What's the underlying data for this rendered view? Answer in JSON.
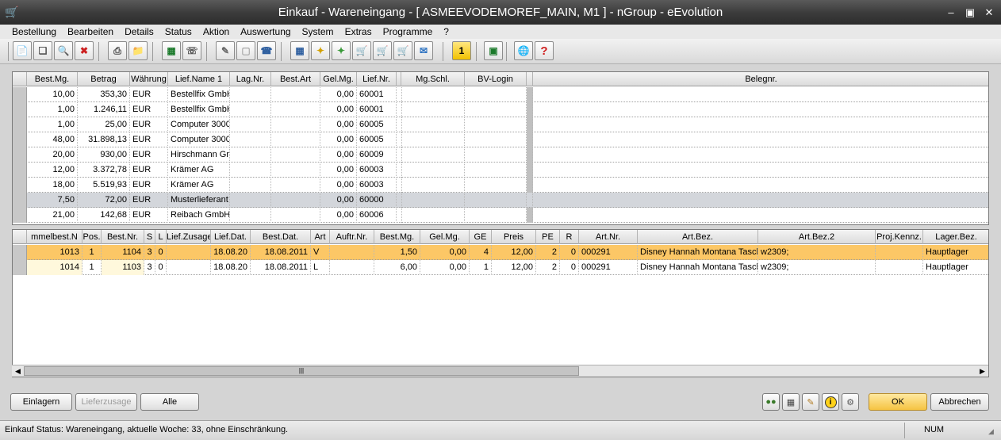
{
  "window": {
    "title": "Einkauf - Wareneingang - [ ASMEEVODEMOREF_MAIN, M1 ]  -  nGroup - eEvolution"
  },
  "menu": [
    "Bestellung",
    "Bearbeiten",
    "Details",
    "Status",
    "Aktion",
    "Auswertung",
    "System",
    "Extras",
    "Programme",
    "?"
  ],
  "toolbar": {
    "icons": [
      "new-icon",
      "copy-icon",
      "search-icon",
      "delete-icon",
      "print-icon",
      "folder-icon",
      "excel-icon",
      "fax-icon",
      "edit-icon",
      "blank-icon",
      "phone-icon",
      "calendar-icon",
      "tag-icon",
      "tag-green-icon",
      "cart-blue-icon",
      "cart-green-icon",
      "cart-red-icon",
      "mail-icon",
      "number-one-icon",
      "exit-icon",
      "globe-icon",
      "help-icon"
    ],
    "badge_one": "1",
    "help_glyph": "?"
  },
  "top_grid": {
    "columns": [
      "Best.Mg.",
      "Betrag",
      "Währung",
      "Lief.Name 1",
      "Lag.Nr.",
      "Best.Art",
      "Gel.Mg.",
      "Lief.Nr.",
      "",
      "Mg.Schl.",
      "BV-Login",
      "",
      "Belegnr."
    ],
    "rows": [
      [
        "10,00",
        "353,30",
        "EUR",
        "Bestellfix GmbH",
        "",
        "",
        "0,00",
        "60001"
      ],
      [
        "1,00",
        "1.246,11",
        "EUR",
        "Bestellfix GmbH",
        "",
        "",
        "0,00",
        "60001"
      ],
      [
        "1,00",
        "25,00",
        "EUR",
        "Computer 3000",
        "",
        "",
        "0,00",
        "60005"
      ],
      [
        "48,00",
        "31.898,13",
        "EUR",
        "Computer 3000",
        "",
        "",
        "0,00",
        "60005"
      ],
      [
        "20,00",
        "930,00",
        "EUR",
        "Hirschmann Gmb",
        "",
        "",
        "0,00",
        "60009"
      ],
      [
        "12,00",
        "3.372,78",
        "EUR",
        "Krämer AG",
        "",
        "",
        "0,00",
        "60003"
      ],
      [
        "18,00",
        "5.519,93",
        "EUR",
        "Krämer AG",
        "",
        "",
        "0,00",
        "60003"
      ],
      [
        "7,50",
        "72,00",
        "EUR",
        "Musterlieferant",
        "",
        "",
        "0,00",
        "60000"
      ],
      [
        "21,00",
        "142,68",
        "EUR",
        "Reibach GmbH",
        "",
        "",
        "0,00",
        "60006"
      ]
    ],
    "selected_row": 7
  },
  "bottom_grid": {
    "columns": [
      "mmelbest.N",
      "Pos.",
      "Best.Nr.",
      "S",
      "L",
      "Lief.Zusage",
      "Lief.Dat.",
      "Best.Dat.",
      "Art",
      "Auftr.Nr.",
      "Best.Mg.",
      "Gel.Mg.",
      "GE",
      "Preis",
      "PE",
      "R",
      "Art.Nr.",
      "Art.Bez.",
      "Art.Bez.2",
      "Proj.Kennz.",
      "Lager.Bez."
    ],
    "rows": [
      [
        "1013",
        "1",
        "1104",
        "3",
        "0",
        "",
        "18.08.20",
        "18.08.2011",
        "V",
        "",
        "1,50",
        "0,00",
        "4",
        "12,00",
        "2",
        "0",
        "000291",
        "Disney Hannah Montana Tascl",
        "w2309;",
        "",
        "Hauptlager"
      ],
      [
        "1014",
        "1",
        "1103",
        "3",
        "0",
        "",
        "18.08.20",
        "18.08.2011",
        "L",
        "",
        "6,00",
        "0,00",
        "1",
        "12,00",
        "2",
        "0",
        "000291",
        "Disney Hannah Montana Tascl",
        "w2309;",
        "",
        "Hauptlager"
      ]
    ],
    "selected_row": 0
  },
  "scrollbar": {
    "thumb_glyph": "|||"
  },
  "buttons": {
    "einlagern": "Einlagern",
    "lieferzusage": "Lieferzusage",
    "alle": "Alle",
    "ok": "OK",
    "abbrechen": "Abbrechen",
    "info_glyph": "i"
  },
  "bottom_icons": [
    "users-icon",
    "calendar-grid-icon",
    "notes-icon",
    "info-icon",
    "tools-icon"
  ],
  "status": {
    "text": "Einkauf Status: Wareneingang, aktuelle Woche: 33, ohne Einschränkung.",
    "num": "NUM"
  },
  "colors": {
    "selected_orange": "#fcc766",
    "selected_gray": "#d3d6db",
    "ok_button": "#f5c342"
  }
}
